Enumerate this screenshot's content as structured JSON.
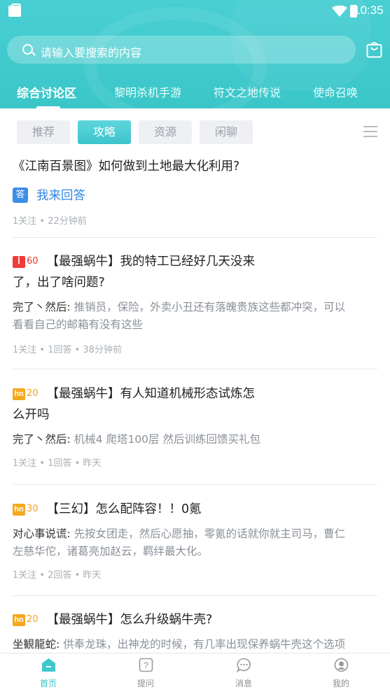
{
  "status_bar": {
    "time": "10:35"
  },
  "search": {
    "placeholder": "请输入要搜索的内容"
  },
  "tabs": [
    {
      "label": "综合讨论区",
      "active": true
    },
    {
      "label": "黎明杀机手游",
      "active": false
    },
    {
      "label": "符文之地传说",
      "active": false
    },
    {
      "label": "使命召唤",
      "active": false
    }
  ],
  "filters": [
    {
      "label": "推荐",
      "active": false
    },
    {
      "label": "攻略",
      "active": true
    },
    {
      "label": "资源",
      "active": false
    },
    {
      "label": "闲聊",
      "active": false
    }
  ],
  "posts": [
    {
      "title": "《江南百景图》如何做到土地最大化利用?",
      "answer_icon": "答",
      "answer_label": "我来回答",
      "meta": "1关注 • 22分钟前"
    },
    {
      "badge": "ꟾ",
      "points": "60",
      "title_line1": "【最强蜗牛】我的特工已经好几天没来",
      "title_line2": "了，出了啥问题?",
      "answer_user": "完了丶然后:",
      "answer_text": "推销员，保险，外卖小丑还有落魄贵族这些都冲突，可以",
      "answer_text2": "看看自己的邮箱有没有这些",
      "meta": "1关注 • 1回答 • 38分钟前"
    },
    {
      "badge": "hn",
      "points": "20",
      "title_line1": "【最强蜗牛】有人知道机械形态试炼怎",
      "title_line2": "么开吗",
      "answer_user": "完了丶然后:",
      "answer_text": "机械4 爬塔100层 然后训练回馈买礼包",
      "meta": "1关注 • 1回答 • 昨天"
    },
    {
      "badge": "hn",
      "points": "30",
      "title_line1": "【三幻】怎么配阵容！！0氪",
      "answer_user": "对心事说谎:",
      "answer_text": "先按女团走，然后心愿抽，零氪的话就你就主司马，曹仁",
      "answer_text2": "左慈华佗，诸葛亮加赵云，羁绊最大化。",
      "meta": "1关注 • 2回答 • 昨天"
    },
    {
      "badge": "hn",
      "points": "20",
      "title_line1": "【最强蜗牛】怎么升级蜗牛壳?",
      "answer_user": "坐観龍蛇:",
      "answer_text": "供奉龙珠，出神龙的时候，有几率出现保养蜗牛壳这个选项"
    }
  ],
  "bottom_nav": [
    {
      "label": "首页",
      "icon": "home-icon",
      "active": true
    },
    {
      "label": "提问",
      "icon": "question-icon",
      "active": false
    },
    {
      "label": "消息",
      "icon": "message-icon",
      "active": false
    },
    {
      "label": "我的",
      "icon": "profile-icon",
      "active": false
    }
  ],
  "colors": {
    "accent": "#3ec8cc",
    "link": "#2f86e6",
    "hot": "#ee3b3b",
    "gold": "#f5a81d"
  }
}
